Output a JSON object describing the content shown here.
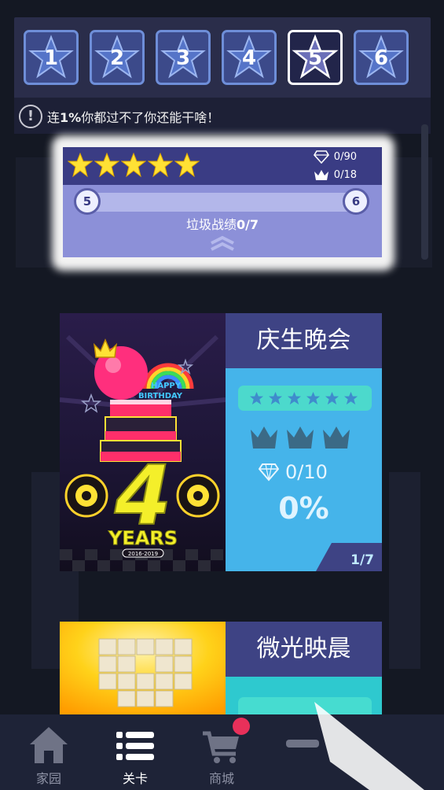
{
  "worlds": [
    "1",
    "2",
    "3",
    "4",
    "5",
    "6"
  ],
  "selected_world": "5",
  "tip": {
    "icon": "exclamation-icon",
    "text_prefix": "连",
    "text_bold": "1%",
    "text_suffix": "你都过不了你还能干啥！"
  },
  "progress": {
    "stars_earned": 5,
    "stars_total": 5,
    "gems": "0/90",
    "crowns": "0/18",
    "from_world": "5",
    "to_world": "6",
    "label_prefix": "垃圾战绩",
    "label_value": "0/7",
    "expand_icon": "chevron-up-icon"
  },
  "levels": [
    {
      "title": "庆生晚会",
      "art_text": "4",
      "art_caption": "YEARS",
      "art_banner": "HAPPY BIRTHDAY",
      "art_years": "2016-2019",
      "stars": 6,
      "gems": "0/10",
      "percent": "0%",
      "index": "1/7"
    },
    {
      "title": "微光映晨"
    }
  ],
  "nav": [
    {
      "label": "家园",
      "icon": "home-icon",
      "active": false
    },
    {
      "label": "关卡",
      "icon": "list-icon",
      "active": true
    },
    {
      "label": "商城",
      "icon": "cart-icon",
      "active": false,
      "badge": true
    }
  ],
  "colors": {
    "background": "#141823",
    "topbar": "#2a2d4a",
    "world_tile": "#3c4a8a",
    "star_gold": "#ffe135",
    "card_blue": "#45b4ea",
    "title_bar": "#3e4384",
    "badge_red": "#e8305a"
  }
}
